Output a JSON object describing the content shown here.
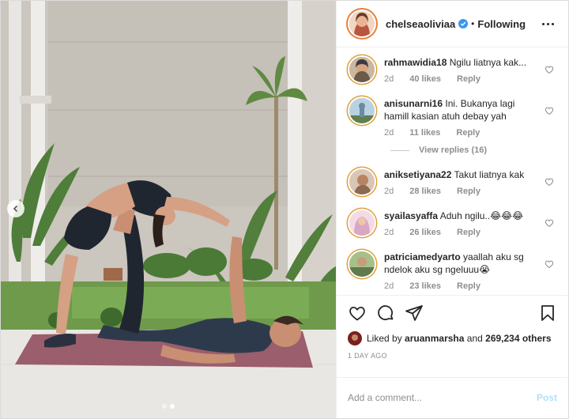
{
  "post": {
    "author": "chelseaoliviaa",
    "separator": "•",
    "follow_status": "Following",
    "verified": true,
    "carousel": {
      "slides": 2,
      "current": 2
    }
  },
  "comments": [
    {
      "username": "rahmawidia18",
      "text": "Ngilu liatnya kak...",
      "age": "2d",
      "likes": "40 likes",
      "reply": "Reply",
      "avatar_color": "#6b5a4a"
    },
    {
      "username": "anisunarni16",
      "text": "Ini. Bukanya lagi hamill kasian atuh debay yah",
      "age": "2d",
      "likes": "11 likes",
      "reply": "Reply",
      "avatar_color": "#6d8aa0"
    },
    {
      "username": "aniksetiyana22",
      "text": "Takut liatnya kak",
      "age": "2d",
      "likes": "28 likes",
      "reply": "Reply",
      "avatar_color": "#8a6b52"
    },
    {
      "username": "syailasyaffa",
      "text": "Aduh ngilu..😂😂😂",
      "age": "2d",
      "likes": "26 likes",
      "reply": "Reply",
      "avatar_color": "#d9a7c2"
    },
    {
      "username": "patriciamedyarto",
      "text": "yaallah aku sg ndelok aku sg ngeluuu😭",
      "age": "2d",
      "likes": "23 likes",
      "reply": "Reply",
      "avatar_color": "#5f7a4c"
    }
  ],
  "view_replies": "View replies (16)",
  "likes_line": {
    "prefix": "Liked by",
    "user": "aruanmarsha",
    "conj": "and",
    "others": "269,234 others"
  },
  "date": "1 DAY AGO",
  "add_comment": {
    "placeholder": "Add a comment...",
    "post_label": "Post"
  },
  "colors": {
    "story_ring": "#e8803c",
    "link_blue": "#b2dffc",
    "verified": "#3897f0",
    "muted": "#8e8e8e"
  }
}
